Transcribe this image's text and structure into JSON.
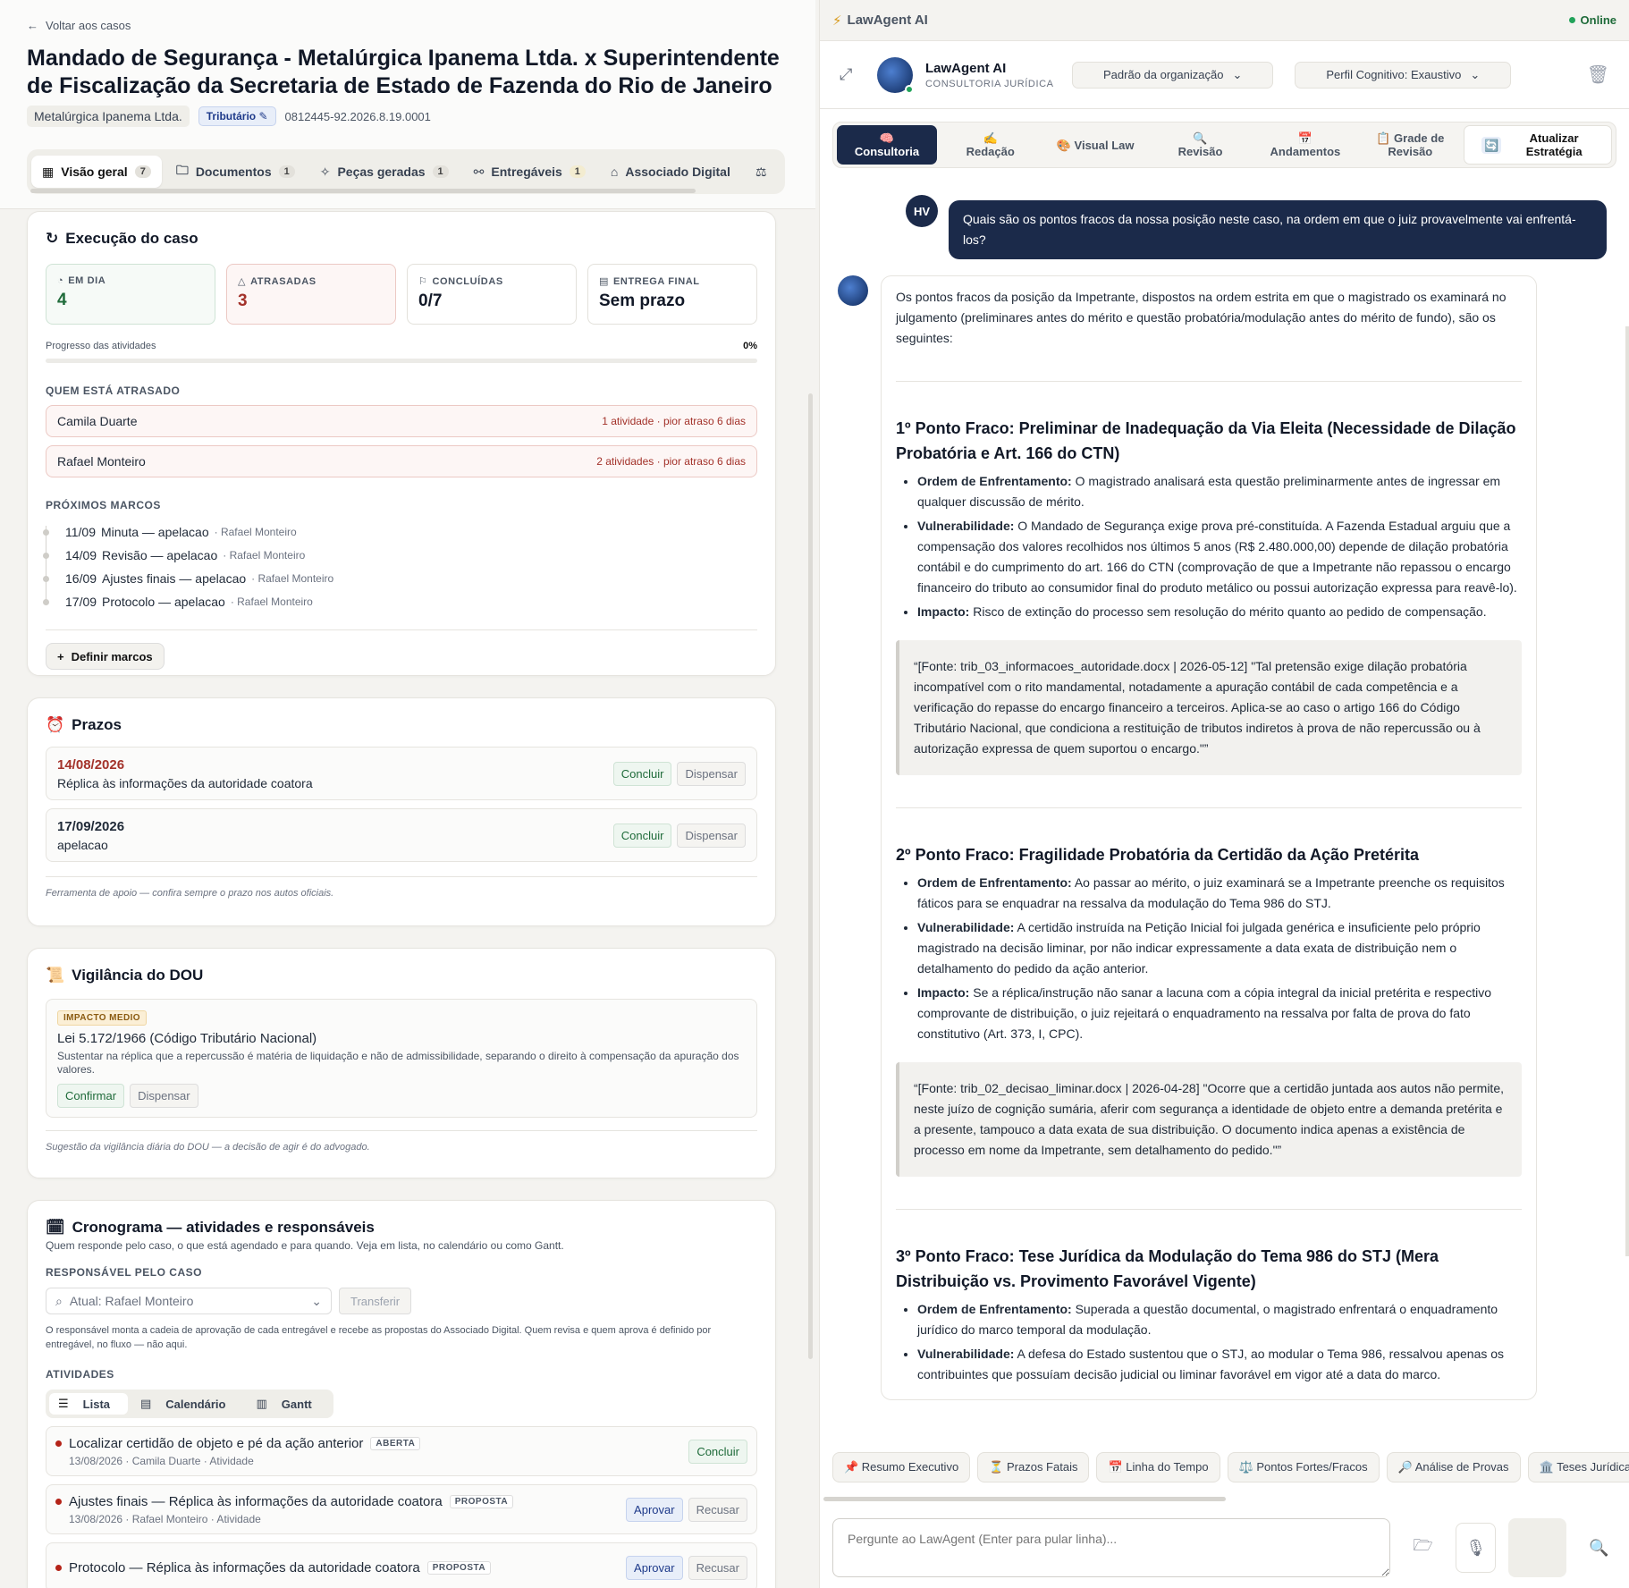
{
  "left": {
    "back_label": "Voltar aos casos",
    "title": "Mandado de Segurança - Metalúrgica Ipanema Ltda. x Superintendente de Fiscalização da Secretaria de Estado de Fazenda do Rio de Janeiro",
    "client": "Metalúrgica Ipanema Ltda.",
    "area": "Tributário",
    "process_number": "0812445-92.2026.8.19.0001",
    "tabs": [
      {
        "label": "Visão geral",
        "count": "7"
      },
      {
        "label": "Documentos",
        "count": "1"
      },
      {
        "label": "Peças geradas",
        "count": "1"
      },
      {
        "label": "Entregáveis",
        "count": "1"
      },
      {
        "label": "Associado Digital",
        "count": ""
      }
    ],
    "execucao": {
      "title": "Execução do caso",
      "stats": [
        {
          "label": "EM DIA",
          "value": "4"
        },
        {
          "label": "ATRASADAS",
          "value": "3"
        },
        {
          "label": "CONCLUÍDAS",
          "value": "0/7"
        },
        {
          "label": "ENTREGA FINAL",
          "value": "Sem prazo"
        }
      ],
      "progress_label": "Progresso das atividades",
      "progress_value": "0%",
      "late_title": "QUEM ESTÁ ATRASADO",
      "late": [
        {
          "name": "Camila Duarte",
          "detail": "1 atividade · pior atraso 6 dias"
        },
        {
          "name": "Rafael Monteiro",
          "detail": "2 atividades · pior atraso 6 dias"
        }
      ],
      "milestones_title": "PRÓXIMOS MARCOS",
      "milestones": [
        {
          "date": "11/09",
          "label": "Minuta — apelacao",
          "who": "· Rafael Monteiro"
        },
        {
          "date": "14/09",
          "label": "Revisão — apelacao",
          "who": "· Rafael Monteiro"
        },
        {
          "date": "16/09",
          "label": "Ajustes finais — apelacao",
          "who": "· Rafael Monteiro"
        },
        {
          "date": "17/09",
          "label": "Protocolo — apelacao",
          "who": "· Rafael Monteiro"
        }
      ],
      "define_label": "Definir marcos"
    },
    "prazos": {
      "title": "Prazos",
      "items": [
        {
          "date": "14/08/2026",
          "text": "Réplica às informações da autoridade coatora"
        },
        {
          "date": "17/09/2026",
          "text": "apelacao"
        }
      ],
      "conclude": "Concluir",
      "dismiss": "Dispensar",
      "note": "Ferramenta de apoio — confira sempre o prazo nos autos oficiais."
    },
    "dou": {
      "title": "Vigilância do DOU",
      "badge": "IMPACTO MEDIO",
      "law": "Lei 5.172/1966 (Código Tributário Nacional)",
      "desc": "Sustentar na réplica que a repercussão é matéria de liquidação e não de admissibilidade, separando o direito à compensação da apuração dos valores.",
      "confirm": "Confirmar",
      "dismiss": "Dispensar",
      "note": "Sugestão da vigilância diária do DOU — a decisão de agir é do advogado."
    },
    "crono": {
      "title": "Cronograma — atividades e responsáveis",
      "subtitle": "Quem responde pelo caso, o que está agendado e para quando. Veja em lista, no calendário ou como Gantt.",
      "resp_title": "RESPONSÁVEL PELO CASO",
      "resp_value": "Atual: Rafael Monteiro",
      "transfer": "Transferir",
      "resp_note": "O responsável monta a cadeia de aprovação de cada entregável e recebe as propostas do Associado Digital. Quem revisa e quem aprova é definido por entregável, no fluxo — não aqui.",
      "acts_title": "ATIVIDADES",
      "views": [
        "Lista",
        "Calendário",
        "Gantt"
      ],
      "activities": [
        {
          "title": "Localizar certidão de objeto e pé da ação anterior",
          "status": "ABERTA",
          "meta": "13/08/2026 · Camila Duarte · Atividade"
        },
        {
          "title": "Ajustes finais — Réplica às informações da autoridade coatora",
          "status": "PROPOSTA",
          "meta": "13/08/2026 · Rafael Monteiro · Atividade"
        },
        {
          "title": "Protocolo — Réplica às informações da autoridade coatora",
          "status": "PROPOSTA",
          "meta": ""
        }
      ],
      "conclude": "Concluir",
      "approve": "Aprovar",
      "reject": "Recusar"
    }
  },
  "right": {
    "app_title": "LawAgent AI",
    "status": "Online",
    "agent_name": "LawAgent AI",
    "agent_sub": "CONSULTORIA JURÍDICA",
    "dropdown1": "Padrão da organização",
    "dropdown2": "Perfil Cognitivo: Exaustivo",
    "tabs": [
      {
        "icon": "🧠",
        "label": "Consultoria"
      },
      {
        "icon": "✍️",
        "label": "Redação"
      },
      {
        "icon": "🎨",
        "label": "Visual Law"
      },
      {
        "icon": "🔍",
        "label": "Revisão"
      },
      {
        "icon": "📅",
        "label": "Andamentos"
      },
      {
        "icon": "📋",
        "label": "Grade de Revisão"
      }
    ],
    "update_label": "Atualizar Estratégia",
    "user_initials": "HV",
    "user_msg": "Quais são os pontos fracos da nossa posição neste caso, na ordem em que o juiz provavelmente vai enfrentá-los?",
    "ai_intro": "Os pontos fracos da posição da Impetrante, dispostos na ordem estrita em que o magistrado os examinará no julgamento (preliminares antes do mérito e questão probatória/modulação antes do mérito de fundo), são os seguintes:",
    "points": [
      {
        "title": "1º Ponto Fraco: Preliminar de Inadequação da Via Eleita (Necessidade de Dilação Probatória e Art. 166 do CTN)",
        "items": [
          {
            "k": "Ordem de Enfrentamento:",
            "v": " O magistrado analisará esta questão preliminarmente antes de ingressar em qualquer discussão de mérito."
          },
          {
            "k": "Vulnerabilidade:",
            "v": " O Mandado de Segurança exige prova pré-constituída. A Fazenda Estadual arguiu que a compensação dos valores recolhidos nos últimos 5 anos (R$ 2.480.000,00) depende de dilação probatória contábil e do cumprimento do art. 166 do CTN (comprovação de que a Impetrante não repassou o encargo financeiro do tributo ao consumidor final do produto metálico ou possui autorização expressa para reavê-lo)."
          },
          {
            "k": "Impacto:",
            "v": " Risco de extinção do processo sem resolução do mérito quanto ao pedido de compensação."
          }
        ],
        "quote": "“[Fonte: trib_03_informacoes_autoridade.docx | 2026-05-12] \"Tal pretensão exige dilação probatória incompatível com o rito mandamental, notadamente a apuração contábil de cada competência e a verificação do repasse do encargo financeiro a terceiros. Aplica-se ao caso o artigo 166 do Código Tributário Nacional, que condiciona a restituição de tributos indiretos à prova de não repercussão ou à autorização expressa de quem suportou o encargo.\"”"
      },
      {
        "title": "2º Ponto Fraco: Fragilidade Probatória da Certidão da Ação Pretérita",
        "items": [
          {
            "k": "Ordem de Enfrentamento:",
            "v": " Ao passar ao mérito, o juiz examinará se a Impetrante preenche os requisitos fáticos para se enquadrar na ressalva da modulação do Tema 986 do STJ."
          },
          {
            "k": "Vulnerabilidade:",
            "v": " A certidão instruída na Petição Inicial foi julgada genérica e insuficiente pelo próprio magistrado na decisão liminar, por não indicar expressamente a data exata de distribuição nem o detalhamento do pedido da ação anterior."
          },
          {
            "k": "Impacto:",
            "v": " Se a réplica/instrução não sanar a lacuna com a cópia integral da inicial pretérita e respectivo comprovante de distribuição, o juiz rejeitará o enquadramento na ressalva por falta de prova do fato constitutivo (Art. 373, I, CPC)."
          }
        ],
        "quote": "“[Fonte: trib_02_decisao_liminar.docx | 2026-04-28] \"Ocorre que a certidão juntada aos autos não permite, neste juízo de cognição sumária, aferir com segurança a identidade de objeto entre a demanda pretérita e a presente, tampouco a data exata de sua distribuição. O documento indica apenas a existência de processo em nome da Impetrante, sem detalhamento do pedido.\"”"
      },
      {
        "title": "3º Ponto Fraco: Tese Jurídica da Modulação do Tema 986 do STJ (Mera Distribuição vs. Provimento Favorável Vigente)",
        "items": [
          {
            "k": "Ordem de Enfrentamento:",
            "v": " Superada a questão documental, o magistrado enfrentará o enquadramento jurídico do marco temporal da modulação."
          },
          {
            "k": "Vulnerabilidade:",
            "v": " A defesa do Estado sustentou que o STJ, ao modular o Tema 986, ressalvou apenas os contribuintes que possuíam decisão judicial ou liminar favorável em vigor até a data do marco."
          }
        ],
        "quote": ""
      }
    ],
    "quick_chips": [
      "📌 Resumo Executivo",
      "⏳ Prazos Fatais",
      "📅 Linha do Tempo",
      "⚖️ Pontos Fortes/Fracos",
      "🔎 Análise de Provas",
      "🏛️ Teses Jurídicas"
    ],
    "input_placeholder": "Pergunte ao LawAgent (Enter para pular linha)..."
  }
}
